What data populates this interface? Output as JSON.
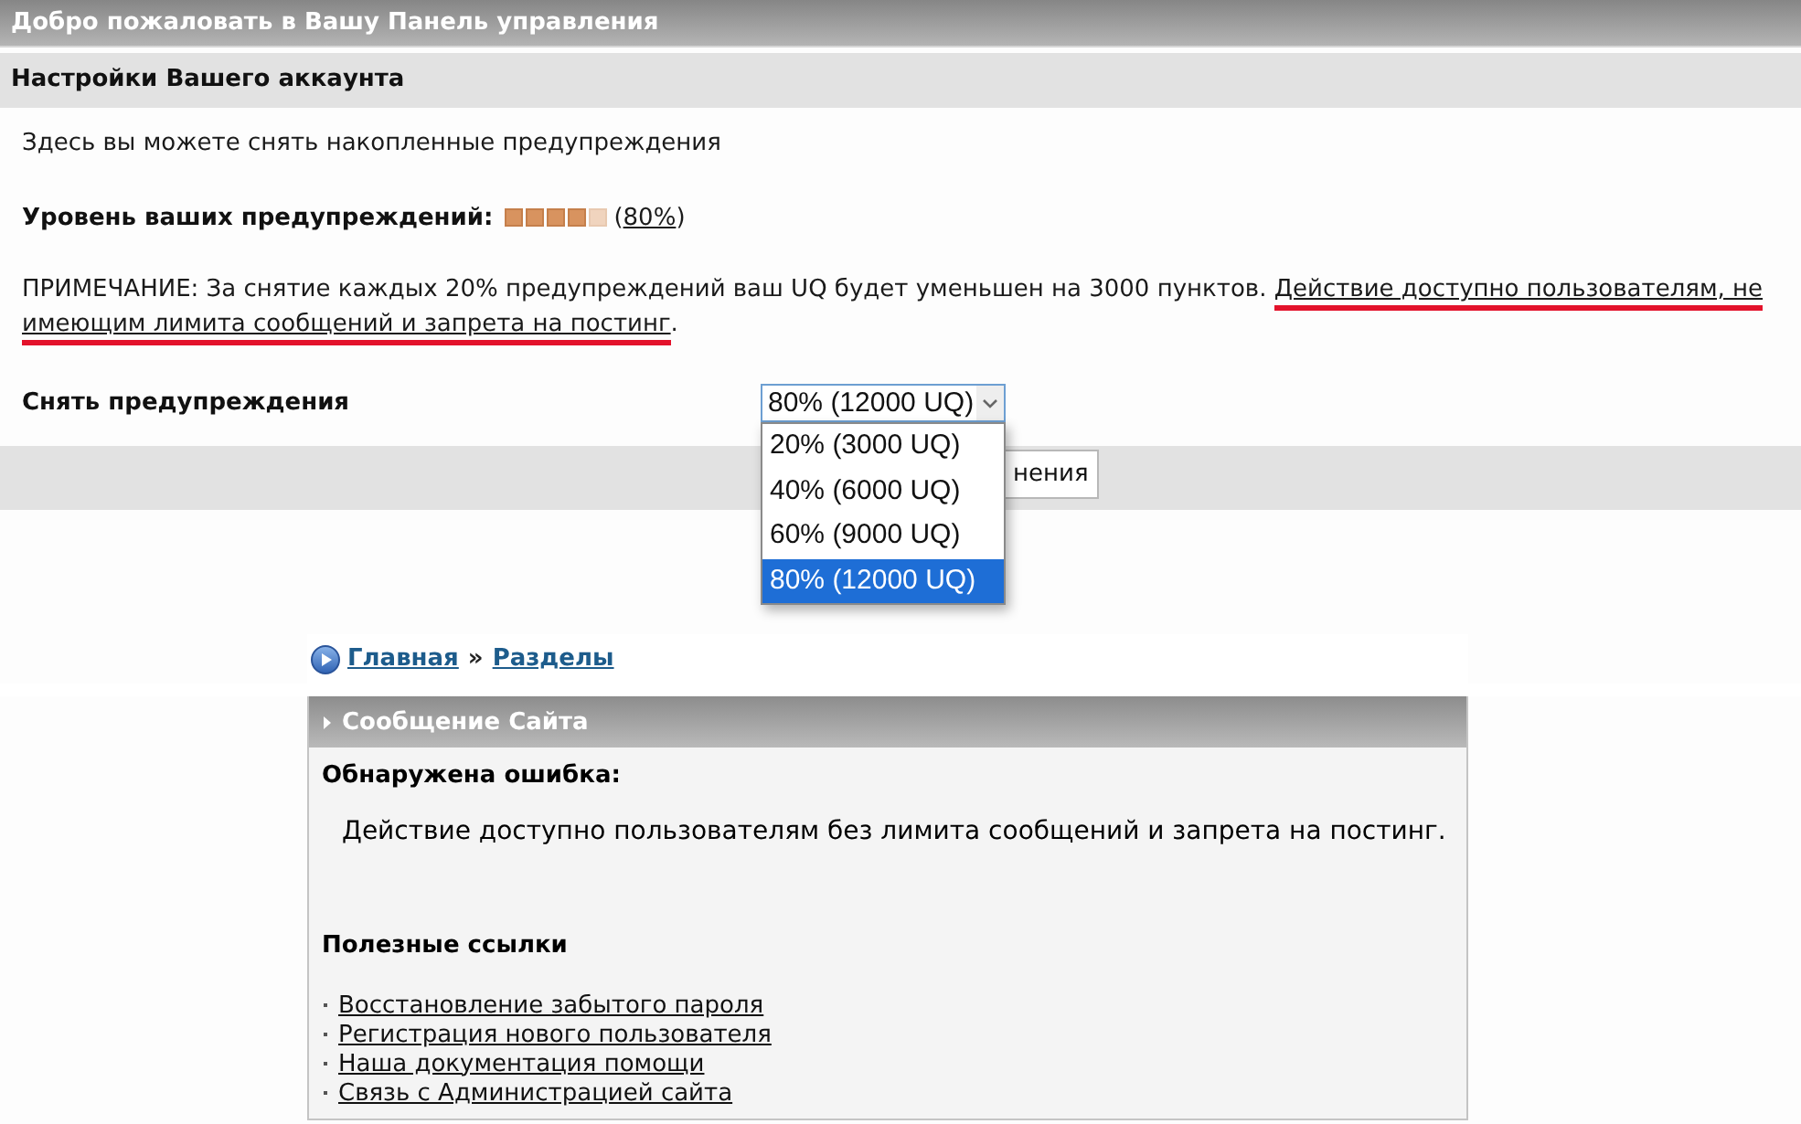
{
  "header": {
    "title": "Добро пожаловать в Вашу Панель управления"
  },
  "account_settings": {
    "title": "Настройки Вашего аккаунта",
    "intro": "Здесь вы можете снять накопленные предупреждения",
    "warning_level": {
      "label": "Уровень ваших предупреждений:",
      "level": 0.8,
      "reading": "(80%)"
    },
    "note": {
      "text": "ПРИМЕЧАНИЕ: За снятие каждых 20% предупреждений ваш UQ будет уменьшен на 3000 пунктов.",
      "underlined": "Действие доступно пользователям, не имеющим лимита сообщений и запрета на постинг",
      "end": ".",
      "highlighted": true
    },
    "remove_warnings": {
      "label": "Снять предупреждения",
      "value": "80% (12000 UQ)",
      "expanded": true,
      "options": [
        {
          "label": "20% (3000 UQ)",
          "selected": false
        },
        {
          "label": "40% (6000 UQ)",
          "selected": false
        },
        {
          "label": "60% (9000 UQ)",
          "selected": false
        },
        {
          "label": "80% (12000 UQ)",
          "selected": true
        }
      ]
    },
    "submit_button": {
      "label": "нения"
    }
  },
  "breadcrumb": {
    "items": [
      "Главная",
      "Разделы"
    ],
    "separator": "»"
  },
  "site_message": {
    "title": "Сообщение Сайта",
    "error_title": "Обнаружена ошибка:",
    "error_text": "Действие доступно пользователям без лимита сообщений и запрета на постинг.",
    "links_title": "Полезные ссылки",
    "links": [
      "Восстановление забытого пароля",
      "Регистрация нового пользователя",
      "Наша документация помощи",
      "Связь с Администрацией сайта"
    ]
  }
}
